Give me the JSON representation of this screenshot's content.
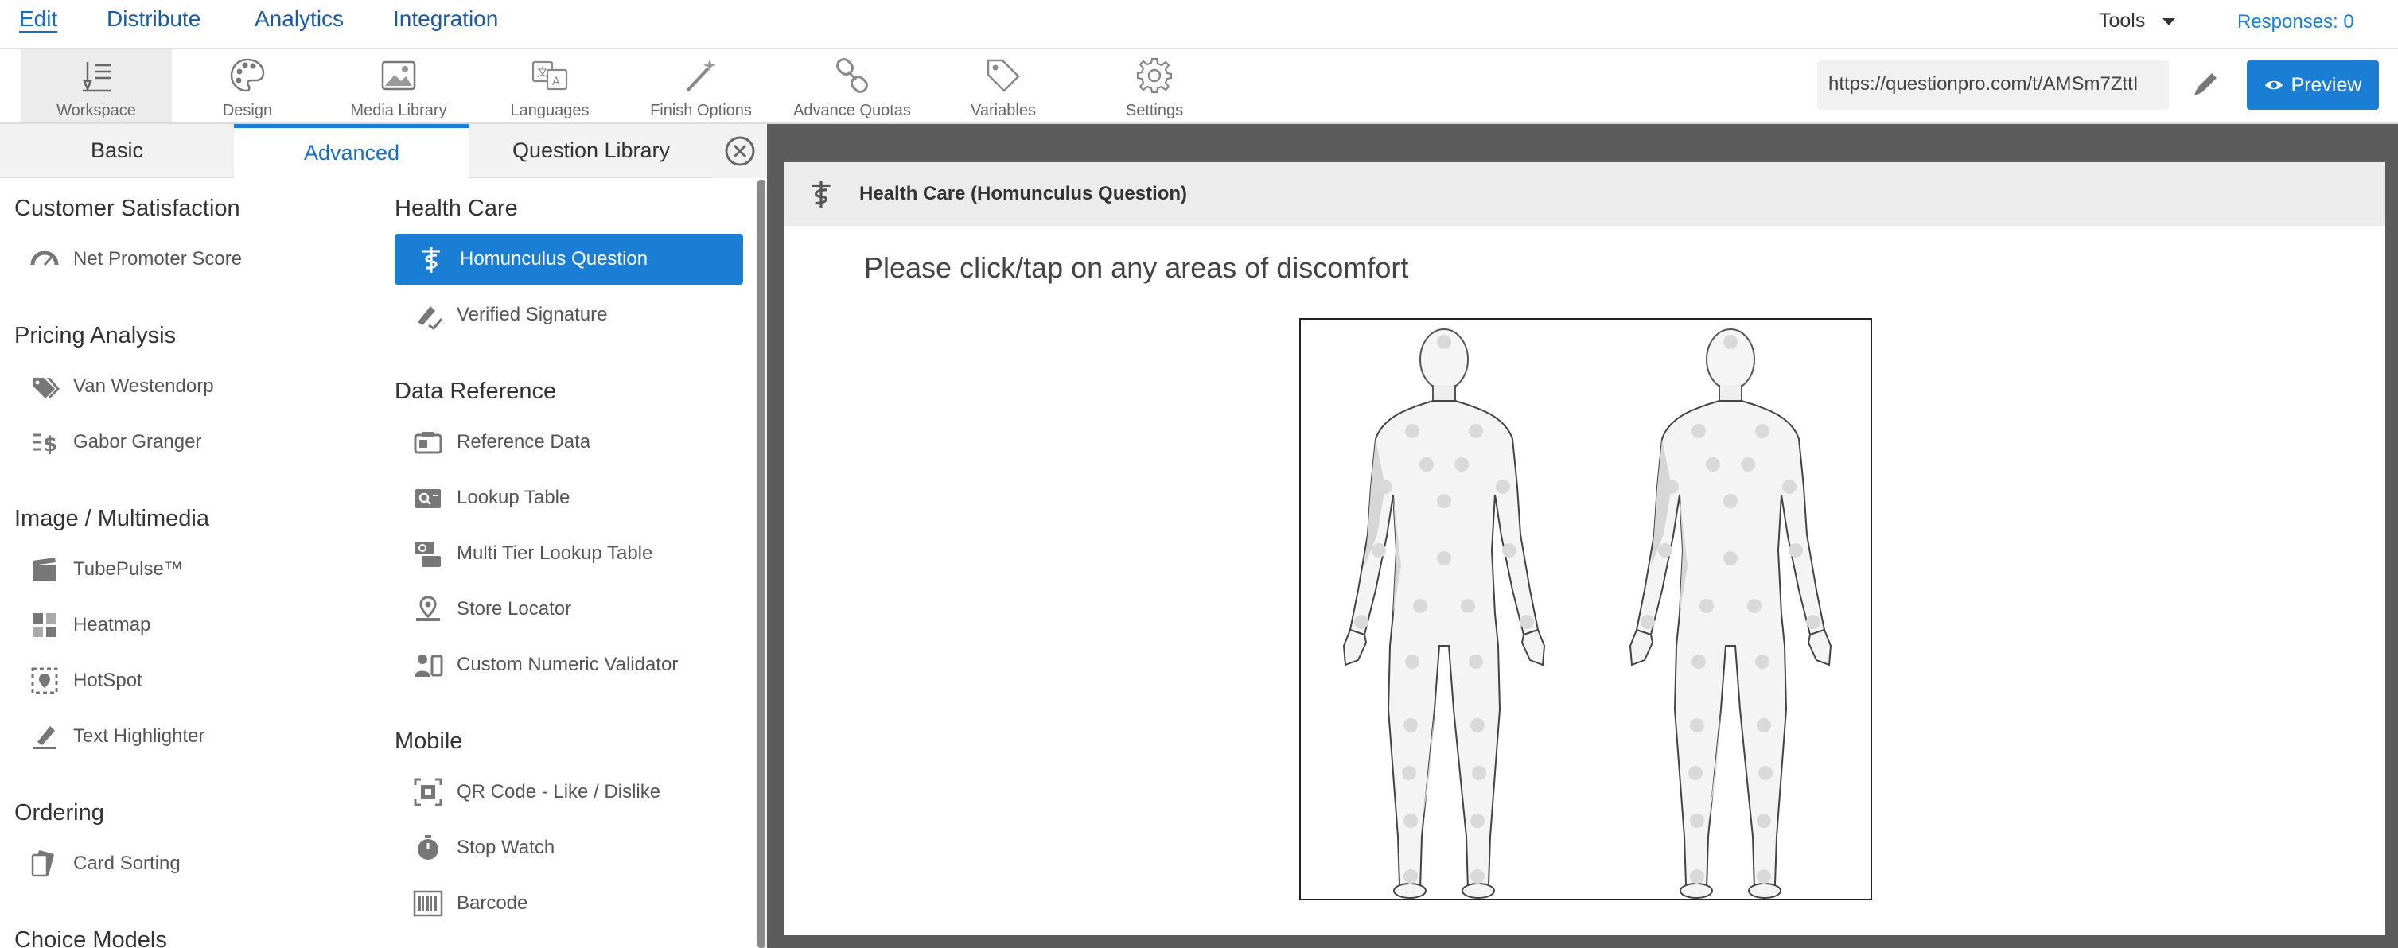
{
  "topnav": {
    "items": [
      "Edit",
      "Distribute",
      "Analytics",
      "Integration"
    ],
    "tools_label": "Tools",
    "responses_label": "Responses: 0"
  },
  "toolbar": {
    "tools": [
      {
        "label": "Workspace",
        "icon": "workspace-icon"
      },
      {
        "label": "Design",
        "icon": "palette-icon"
      },
      {
        "label": "Media Library",
        "icon": "image-icon"
      },
      {
        "label": "Languages",
        "icon": "translate-icon"
      },
      {
        "label": "Finish Options",
        "icon": "magic-wand-icon"
      },
      {
        "label": "Advance Quotas",
        "icon": "link-icon"
      },
      {
        "label": "Variables",
        "icon": "tag-icon"
      },
      {
        "label": "Settings",
        "icon": "gear-icon"
      }
    ],
    "url": "https://questionpro.com/t/AMSm7ZttI",
    "preview_label": "Preview"
  },
  "left_panel": {
    "tabs": [
      "Basic",
      "Advanced",
      "Question Library"
    ],
    "active_tab": "Advanced",
    "col1": [
      {
        "title": "Customer Satisfaction",
        "items": [
          {
            "label": "Net Promoter Score",
            "icon": "gauge-icon"
          }
        ]
      },
      {
        "title": "Pricing Analysis",
        "items": [
          {
            "label": "Van Westendorp",
            "icon": "tags-icon"
          },
          {
            "label": "Gabor Granger",
            "icon": "dollar-list-icon"
          }
        ]
      },
      {
        "title": "Image / Multimedia",
        "items": [
          {
            "label": "TubePulse™",
            "icon": "clapper-icon"
          },
          {
            "label": "Heatmap",
            "icon": "heatmap-icon"
          },
          {
            "label": "HotSpot",
            "icon": "hotspot-icon"
          },
          {
            "label": "Text Highlighter",
            "icon": "highlighter-icon"
          }
        ]
      },
      {
        "title": "Ordering",
        "items": [
          {
            "label": "Card Sorting",
            "icon": "cards-icon"
          }
        ]
      },
      {
        "title": "Choice Models",
        "items": []
      }
    ],
    "col2": [
      {
        "title": "Health Care",
        "items": [
          {
            "label": "Homunculus Question",
            "icon": "caduceus-icon",
            "selected": true
          },
          {
            "label": "Verified Signature",
            "icon": "signature-icon"
          }
        ]
      },
      {
        "title": "Data Reference",
        "items": [
          {
            "label": "Reference Data",
            "icon": "reference-icon"
          },
          {
            "label": "Lookup Table",
            "icon": "lookup-icon"
          },
          {
            "label": "Multi Tier Lookup Table",
            "icon": "multi-lookup-icon"
          },
          {
            "label": "Store Locator",
            "icon": "map-pin-icon"
          },
          {
            "label": "Custom Numeric Validator",
            "icon": "validator-icon"
          }
        ]
      },
      {
        "title": "Mobile",
        "items": [
          {
            "label": "QR Code - Like / Dislike",
            "icon": "qr-icon"
          },
          {
            "label": "Stop Watch",
            "icon": "stopwatch-icon"
          },
          {
            "label": "Barcode",
            "icon": "barcode-icon"
          }
        ]
      }
    ]
  },
  "question": {
    "header_title": "Health Care (Homunculus Question)",
    "text": "Please click/tap on any areas of discomfort"
  },
  "colors": {
    "accent": "#1a7fd4",
    "canvas_bg": "#5c5c5c",
    "header_bg": "#ececec"
  }
}
